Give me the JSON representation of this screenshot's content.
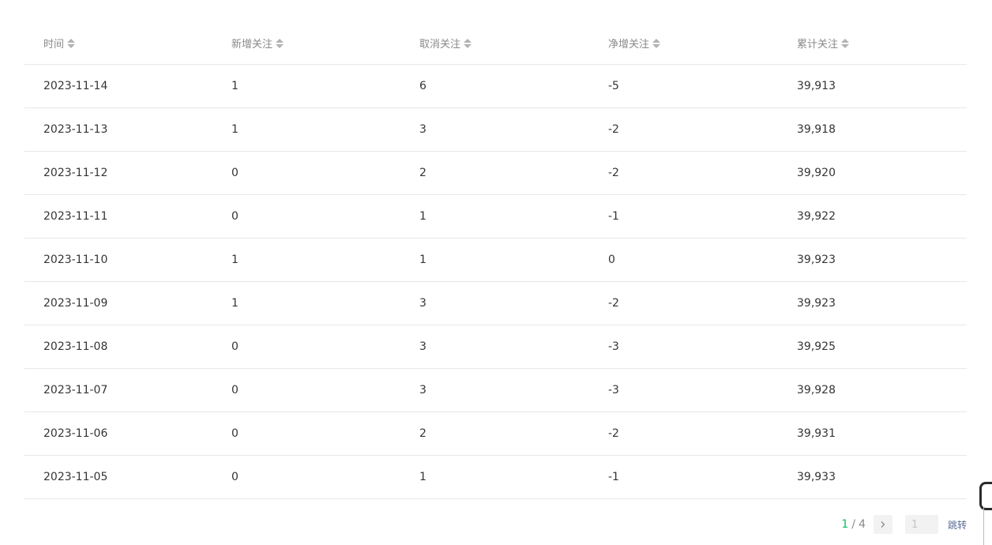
{
  "table": {
    "columns": [
      {
        "label": "时间"
      },
      {
        "label": "新增关注"
      },
      {
        "label": "取消关注"
      },
      {
        "label": "净增关注"
      },
      {
        "label": "累计关注"
      }
    ],
    "rows": [
      [
        "2023-11-14",
        "1",
        "6",
        "-5",
        "39,913"
      ],
      [
        "2023-11-13",
        "1",
        "3",
        "-2",
        "39,918"
      ],
      [
        "2023-11-12",
        "0",
        "2",
        "-2",
        "39,920"
      ],
      [
        "2023-11-11",
        "0",
        "1",
        "-1",
        "39,922"
      ],
      [
        "2023-11-10",
        "1",
        "1",
        "0",
        "39,923"
      ],
      [
        "2023-11-09",
        "1",
        "3",
        "-2",
        "39,923"
      ],
      [
        "2023-11-08",
        "0",
        "3",
        "-3",
        "39,925"
      ],
      [
        "2023-11-07",
        "0",
        "3",
        "-3",
        "39,928"
      ],
      [
        "2023-11-06",
        "0",
        "2",
        "-2",
        "39,931"
      ],
      [
        "2023-11-05",
        "0",
        "1",
        "-1",
        "39,933"
      ]
    ]
  },
  "pagination": {
    "current_page": "1",
    "separator": "/",
    "total_pages": "4",
    "next_icon": "chevron-right-icon",
    "input_placeholder": "1",
    "jump_label": "跳转"
  },
  "colors": {
    "accent_green": "#07c160",
    "link_blue": "#576b95",
    "divider": "#e7e7e7"
  }
}
